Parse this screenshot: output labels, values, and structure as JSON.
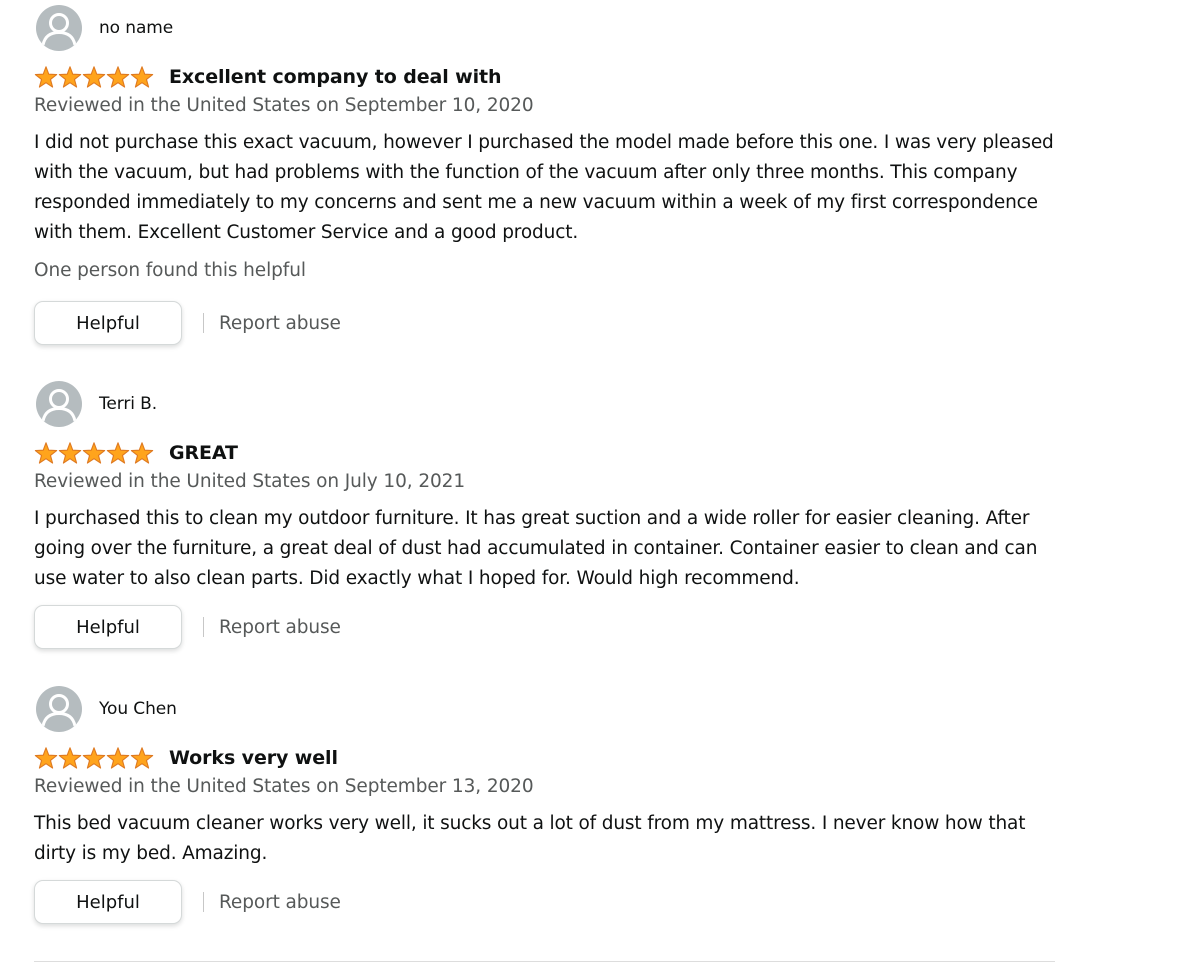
{
  "colors": {
    "star_fill": "#ffa41c",
    "star_stroke": "#de7921",
    "secondary_text": "#565959",
    "avatar_bg": "#b5bcbf"
  },
  "reviews": [
    {
      "reviewer": "no name",
      "rating": 5,
      "title": "Excellent company to deal with",
      "date": "Reviewed in the United States on September 10, 2020",
      "body": "I did not purchase this exact vacuum, however I purchased the model made before this one. I was very pleased with the vacuum, but had problems with the function of the vacuum after only three months. This company responded immediately to my concerns and sent me a new vacuum within a week of my first correspondence with them. Excellent Customer Service and a good product.",
      "helpful_count": "One person found this helpful",
      "helpful_label": "Helpful",
      "report_label": "Report abuse"
    },
    {
      "reviewer": "Terri B.",
      "rating": 5,
      "title": "GREAT",
      "date": "Reviewed in the United States on July 10, 2021",
      "body": "I purchased this to clean my outdoor furniture. It has great suction and a wide roller for easier cleaning. After going over the furniture, a great deal of dust had accumulated in container. Container easier to clean and can use water to also clean parts. Did exactly what I hoped for. Would high recommend.",
      "helpful_label": "Helpful",
      "report_label": "Report abuse"
    },
    {
      "reviewer": "You Chen",
      "rating": 5,
      "title": "Works very well",
      "date": "Reviewed in the United States on September 13, 2020",
      "body": "This bed vacuum cleaner works very well, it sucks out a lot of dust from my mattress. I never know how that dirty is my bed. Amazing.",
      "helpful_label": "Helpful",
      "report_label": "Report abuse"
    }
  ]
}
